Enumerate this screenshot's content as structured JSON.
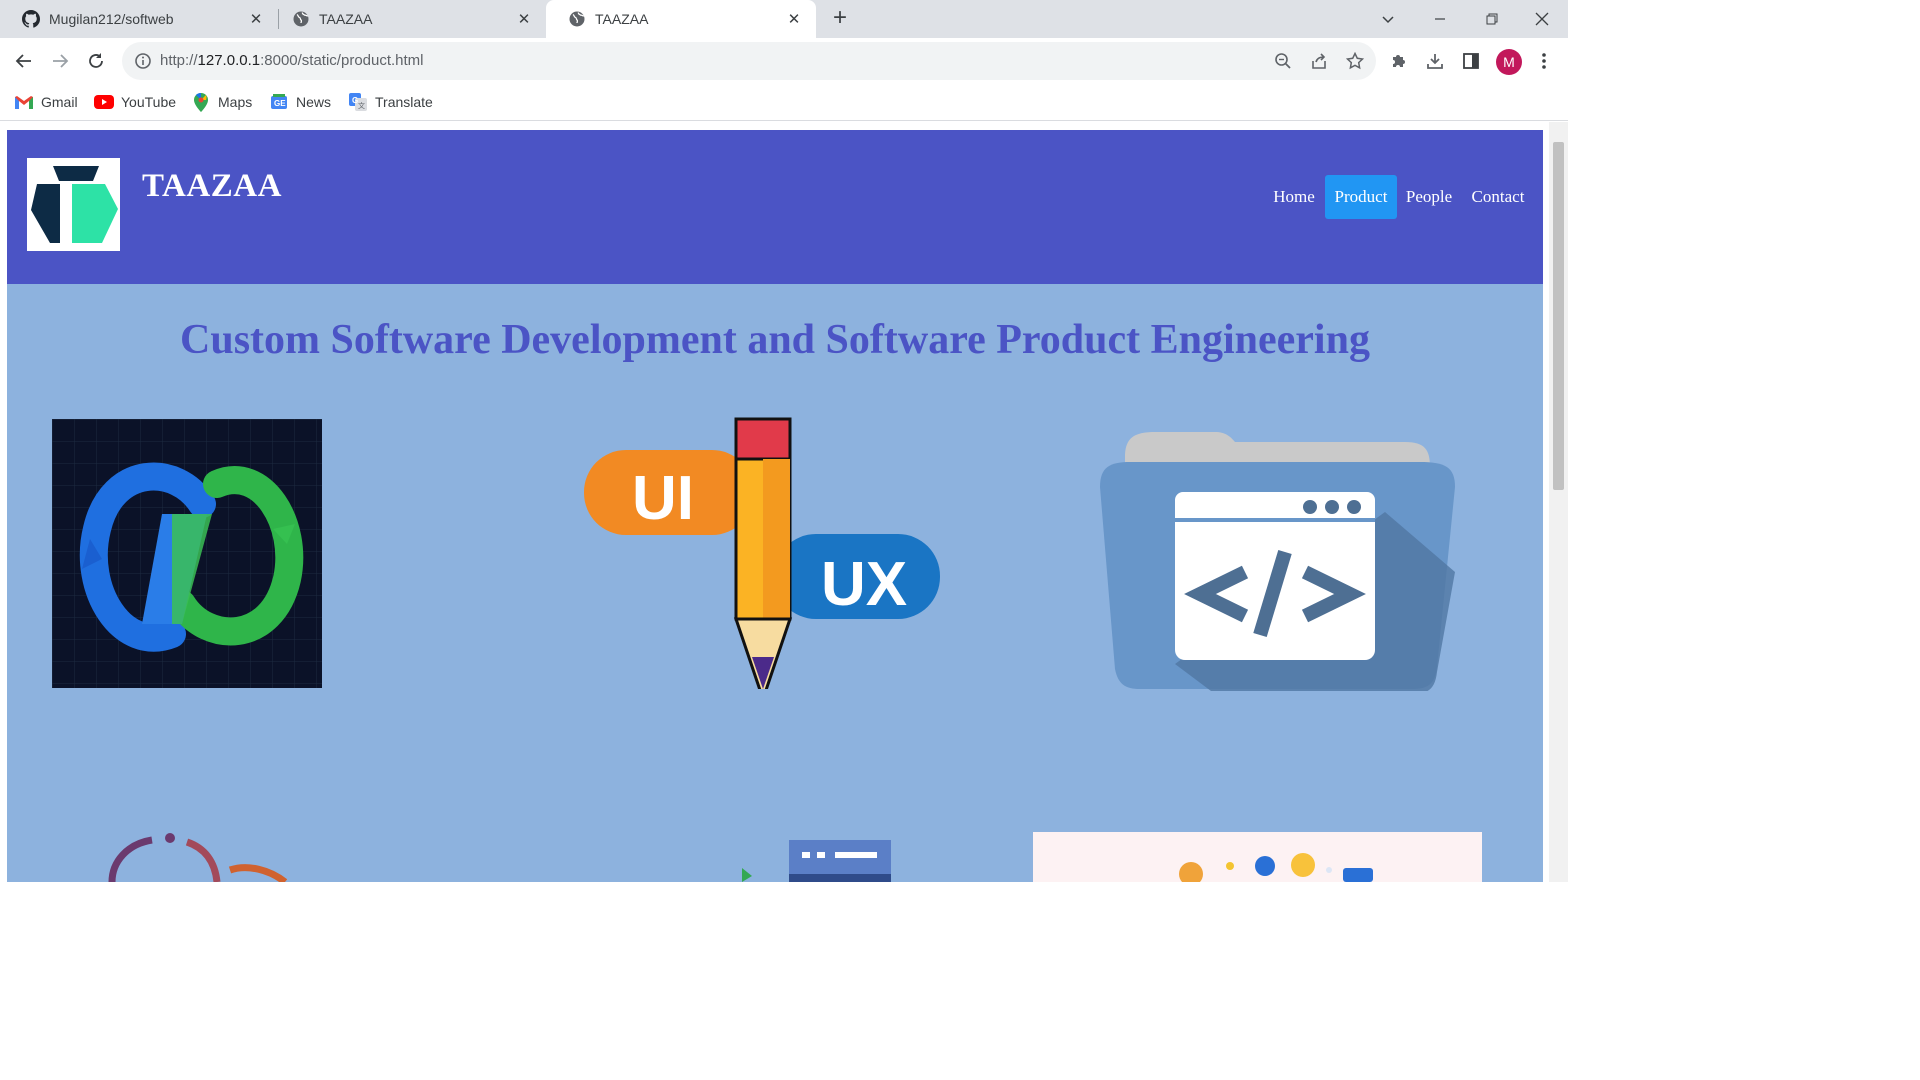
{
  "browser": {
    "tabs": [
      {
        "title": "Mugilan212/softweb",
        "favicon": "github-icon"
      },
      {
        "title": "TAAZAA",
        "favicon": "globe-icon"
      },
      {
        "title": "TAAZAA",
        "favicon": "globe-icon",
        "active": true
      }
    ],
    "url_host": "127.0.0.1",
    "url_prefix": "http://",
    "url_rest": ":8000/static/product.html",
    "bookmarks": [
      {
        "label": "Gmail",
        "icon": "gmail-icon"
      },
      {
        "label": "YouTube",
        "icon": "youtube-icon"
      },
      {
        "label": "Maps",
        "icon": "maps-icon"
      },
      {
        "label": "News",
        "icon": "news-icon"
      },
      {
        "label": "Translate",
        "icon": "translate-icon"
      }
    ],
    "profile_initial": "M"
  },
  "site": {
    "brand": "TAAZAA",
    "nav": [
      "Home",
      "Product",
      "People",
      "Contact"
    ],
    "active_nav": "Product",
    "hero_title": "Custom Software Development and Software Product Engineering",
    "images": {
      "devops_alt": "devops-infinity-image",
      "uiux_label_1": "UI",
      "uiux_label_2": "UX",
      "code_folder_alt": "code-folder-image"
    }
  },
  "colors": {
    "header_bg": "#4b54c5",
    "page_bg": "#8db2de",
    "active_nav": "#2196f3",
    "title": "#4b54c5"
  }
}
